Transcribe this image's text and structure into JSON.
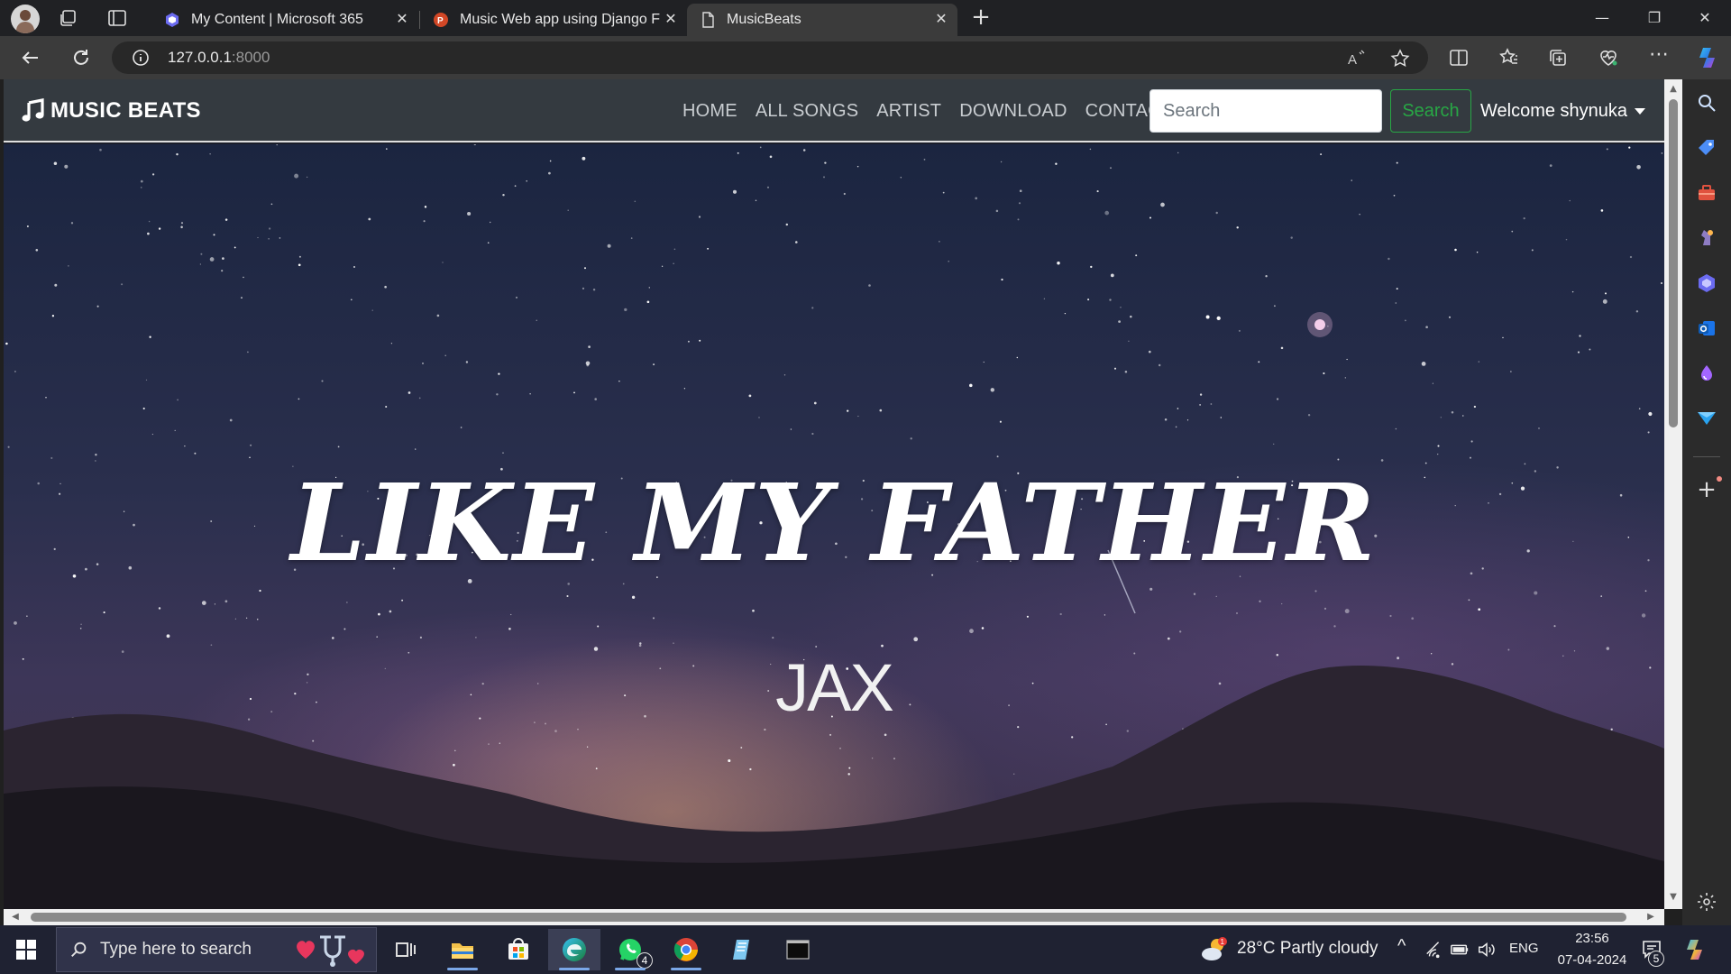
{
  "browser": {
    "tabs": [
      {
        "title": "My Content | Microsoft 365",
        "favicon": "microsoft-365-icon"
      },
      {
        "title": "Music Web app using Django Fra",
        "favicon": "powerpoint-icon"
      },
      {
        "title": "MusicBeats",
        "favicon": "page-icon",
        "active": true
      }
    ],
    "new_tab": "+",
    "address": {
      "host": "127.0.0.1",
      "port": ":8000"
    }
  },
  "site": {
    "brand": "MUSIC BEATS",
    "nav": [
      "HOME",
      "ALL SONGS",
      "ARTIST",
      "DOWNLOAD",
      "CONTACT"
    ],
    "search_placeholder": "Search",
    "search_button": "Search",
    "welcome": "Welcome shynuka",
    "colors": {
      "navbar": "#343a40",
      "search_button": "#28a745"
    }
  },
  "hero": {
    "title": "LIKE MY FATHER",
    "artist": "JAX"
  },
  "taskbar": {
    "search_placeholder": "Type here to search",
    "whatsapp_badge": "4",
    "weather": "28°C  Partly cloudy",
    "language": "ENG",
    "time": "23:56",
    "date": "07-04-2024",
    "notifications": "5"
  }
}
